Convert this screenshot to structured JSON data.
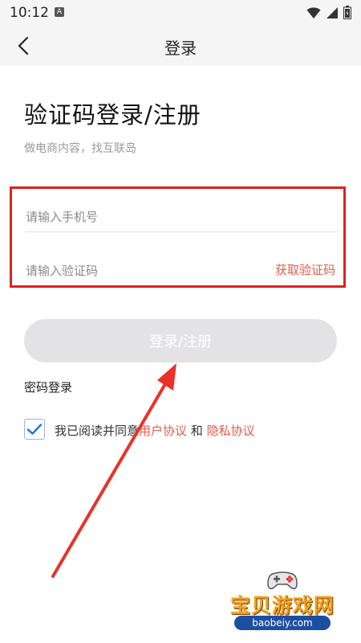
{
  "status_bar": {
    "time": "10:12",
    "notification_badge": "A",
    "icons": [
      "wifi-icon",
      "signal-icon",
      "battery-icon"
    ]
  },
  "nav": {
    "title": "登录",
    "back_icon": "chevron-left-icon"
  },
  "main": {
    "heading": "验证码登录/注册",
    "subtitle": "做电商内容，找互联岛",
    "phone_placeholder": "请输入手机号",
    "code_placeholder": "请输入验证码",
    "get_code_label": "获取验证码",
    "submit_label": "登录/注册",
    "password_login_label": "密码登录"
  },
  "agreement": {
    "checked": true,
    "prefix": "我已阅读并同意",
    "user_agreement": "用户协议",
    "and": "和",
    "privacy_agreement": "隐私协议"
  },
  "watermark": {
    "title": "宝贝游戏网",
    "url": "baobeiy.com"
  },
  "colors": {
    "accent_red": "#e35b4b",
    "highlight_box": "#e02020",
    "button_disabled": "#e3e3e5",
    "checkbox_check": "#1a73d9",
    "annotation_arrow": "#e8322a"
  }
}
